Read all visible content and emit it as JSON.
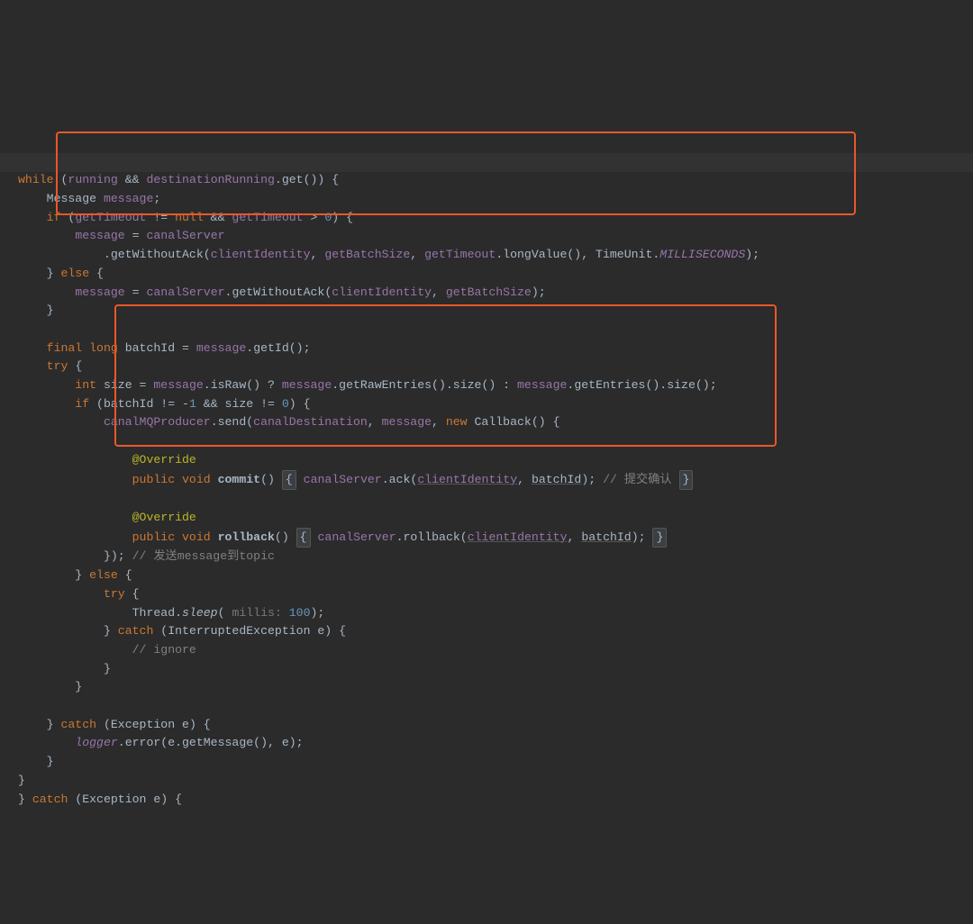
{
  "code": {
    "l0_a": "while",
    "l0_b": " (",
    "l0_c": "running",
    "l0_d": " && ",
    "l0_e": "destinationRunning",
    "l0_f": ".get()) {",
    "l1_a": "    Message ",
    "l1_b": "message",
    "l1_c": ";",
    "l2_a": "    if",
    "l2_b": " (",
    "l2_c": "getTimeout",
    "l2_d": " != ",
    "l2_e": "null",
    "l2_f": " && ",
    "l2_g": "getTimeout",
    "l2_h": " > ",
    "l2_i": "0",
    "l2_j": ") {",
    "l3_a": "        ",
    "l3_b": "message",
    "l3_c": " = ",
    "l3_d": "canalServer",
    "l4_a": "            .getWithoutAck(",
    "l4_b": "clientIdentity",
    "l4_c": ", ",
    "l4_d": "getBatchSize",
    "l4_e": ", ",
    "l4_f": "getTimeout",
    "l4_g": ".longValue(), TimeUnit.",
    "l4_h": "MILLISECONDS",
    "l4_i": ");",
    "l5_a": "    } ",
    "l5_b": "else",
    "l5_c": " {",
    "l6_a": "        ",
    "l6_b": "message",
    "l6_c": " = ",
    "l6_d": "canalServer",
    "l6_e": ".getWithoutAck(",
    "l6_f": "clientIdentity",
    "l6_g": ", ",
    "l6_h": "getBatchSize",
    "l6_i": ");",
    "l7_a": "    }",
    "l8_a": "",
    "l9_a": "    final long ",
    "l9_b": "batchId",
    "l9_c": " = ",
    "l9_d": "message",
    "l9_e": ".getId();",
    "l10_a": "    try",
    "l10_b": " {",
    "l11_a": "        int",
    "l11_b": " size = ",
    "l11_c": "message",
    "l11_d": ".isRaw() ? ",
    "l11_e": "message",
    "l11_f": ".getRawEntries().size() : ",
    "l11_g": "message",
    "l11_h": ".getEntries().size();",
    "l12_a": "        if",
    "l12_b": " (",
    "l12_c": "batchId",
    "l12_d": " != -",
    "l12_e": "1",
    "l12_f": " && size != ",
    "l12_g": "0",
    "l12_h": ") {",
    "l13_a": "            ",
    "l13_b": "canalMQProducer",
    "l13_c": ".send(",
    "l13_d": "canalDestination",
    "l13_e": ", ",
    "l13_f": "message",
    "l13_g": ", ",
    "l13_h": "new",
    "l13_i": " Callback() {",
    "l14_a": "",
    "l15_a": "                ",
    "l15_b": "@Override",
    "l16_a": "                ",
    "l16_b": "public void ",
    "l16_c": "commit",
    "l16_d": "() ",
    "l16_e": "{",
    "l16_f": " ",
    "l16_g": "canalServer",
    "l16_h": ".ack(",
    "l16_i": "clientIdentity",
    "l16_j": ", ",
    "l16_k": "batchId",
    "l16_l": "); ",
    "l16_m": "// 提交确认",
    "l16_n": " ",
    "l16_o": "}",
    "l17_a": "",
    "l18_a": "                ",
    "l18_b": "@Override",
    "l19_a": "                ",
    "l19_b": "public void ",
    "l19_c": "rollback",
    "l19_d": "() ",
    "l19_e": "{",
    "l19_f": " ",
    "l19_g": "canalServer",
    "l19_h": ".rollback(",
    "l19_i": "clientIdentity",
    "l19_j": ", ",
    "l19_k": "batchId",
    "l19_l": "); ",
    "l19_m": "}",
    "l20_a": "            }); ",
    "l20_b": "// 发送message到topic",
    "l21_a": "        } ",
    "l21_b": "else",
    "l21_c": " {",
    "l22_a": "            try",
    "l22_b": " {",
    "l23_a": "                Thread.",
    "l23_b": "sleep",
    "l23_c": "(",
    "l23_d": " millis: ",
    "l23_e": "100",
    "l23_f": ");",
    "l24_a": "            } ",
    "l24_b": "catch",
    "l24_c": " (InterruptedException e) {",
    "l25_a": "                ",
    "l25_b": "// ignore",
    "l26_a": "            }",
    "l27_a": "        }",
    "l28_a": "",
    "l29_a": "    } ",
    "l29_b": "catch",
    "l29_c": " (Exception e) {",
    "l30_a": "        ",
    "l30_b": "logger",
    "l30_c": ".error(e.getMessage(), e);",
    "l31_a": "    }",
    "l32_a": "}",
    "l33_a": "} ",
    "l33_b": "catch",
    "l33_c": " (Exception e) {"
  }
}
